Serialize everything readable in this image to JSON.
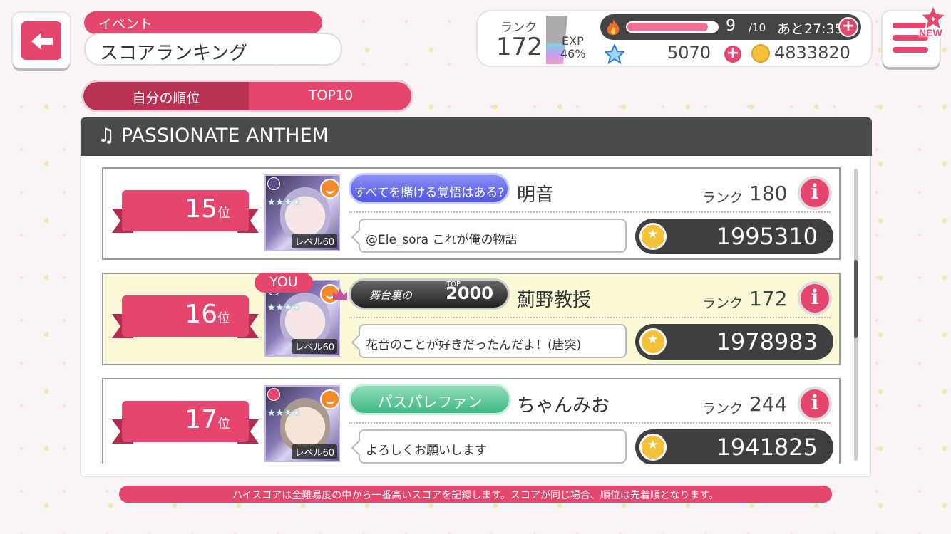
{
  "header": {
    "category": "イベント",
    "title": "スコアランキング"
  },
  "status": {
    "rank_label": "ランク",
    "rank": "172",
    "exp_label": "EXP",
    "exp_percent": "46%",
    "exp_fill": 0.46,
    "stamina": "9",
    "stamina_max": "/10",
    "stamina_timer": "あと27:35",
    "stamina_fill": 0.9,
    "stars": "5070",
    "coins": "4833820"
  },
  "menu": {
    "new_badge": "NEW"
  },
  "tabs": [
    {
      "label": "自分の順位"
    },
    {
      "label": "TOP10"
    }
  ],
  "song": {
    "title": "♫ PASSIONATE ANTHEM"
  },
  "rows": [
    {
      "rank": "15",
      "rank_suffix": "位",
      "title_badge": "すべてを賭ける覚悟はある?",
      "name": "明音",
      "rank_label": "ランク",
      "player_rank": "180",
      "comment": "@Ele_sora これが俺の物語",
      "score": "1995310",
      "level": "レベル60",
      "you": false
    },
    {
      "rank": "16",
      "rank_suffix": "位",
      "you_label": "YOU",
      "title_badge": "舞台裏の",
      "title_badge_top": "TOP",
      "title_badge_num": "2000",
      "name": "薊野教授",
      "rank_label": "ランク",
      "player_rank": "172",
      "comment": "花音のことが好きだったんだよ！(唐突)",
      "score": "1978983",
      "level": "レベル60",
      "you": true
    },
    {
      "rank": "17",
      "rank_suffix": "位",
      "title_badge": "パスパレファン",
      "name": "ちゃんみお",
      "rank_label": "ランク",
      "player_rank": "244",
      "comment": "よろしくお願いします",
      "score": "1941825",
      "level": "レベル60",
      "you": false
    }
  ],
  "footer": "ハイスコアは全難易度の中から一番高いスコアを記録します。スコアが同じ場合、順位は先着順となります。",
  "colors": {
    "accent": "#e5466e",
    "dark_panel": "#4a4a4a",
    "you_row_bg": "#fbf8d8"
  }
}
